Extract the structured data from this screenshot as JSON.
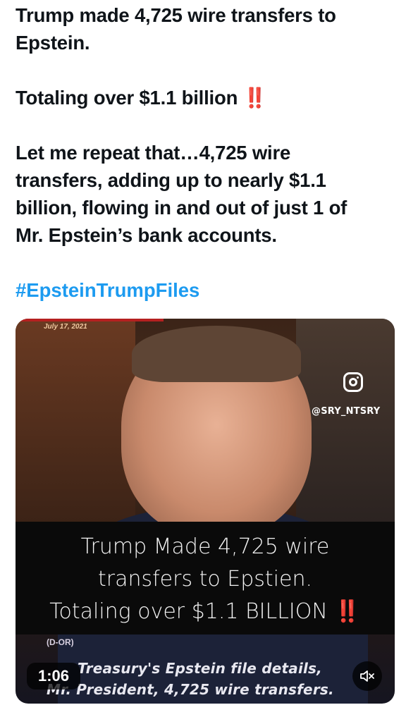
{
  "post": {
    "line1": "Trump made 4,725 wire transfers to",
    "line2": "Epstein.",
    "line3": "Totaling over $1.1 billion",
    "line3_emoji": "‼️",
    "line4": "Let me repeat that…4,725 wire",
    "line5": "transfers, adding up to nearly $1.1",
    "line6": "billion, flowing in and out of just 1 of",
    "line7": "Mr. Epstein’s bank accounts.",
    "hashtag": "#EpsteinTrumpFiles"
  },
  "video": {
    "date_stamp": "July 17, 2021",
    "handle": "@SRY_NTSRY",
    "caption_line1": "Trump Made 4,725 wire",
    "caption_line2": "transfers to Epstien.",
    "caption_line3": "Totaling over $1.1 BILLION",
    "caption_emoji": "‼️",
    "party_tag": "(D-OR)",
    "lower_third_line1": "Treasury's Epstein file details,",
    "lower_third_line2": "Mr. President, 4,725 wire transfers.",
    "timer": "1:06",
    "mute_icon": "volume-muted-icon",
    "instagram_icon": "instagram-icon"
  }
}
